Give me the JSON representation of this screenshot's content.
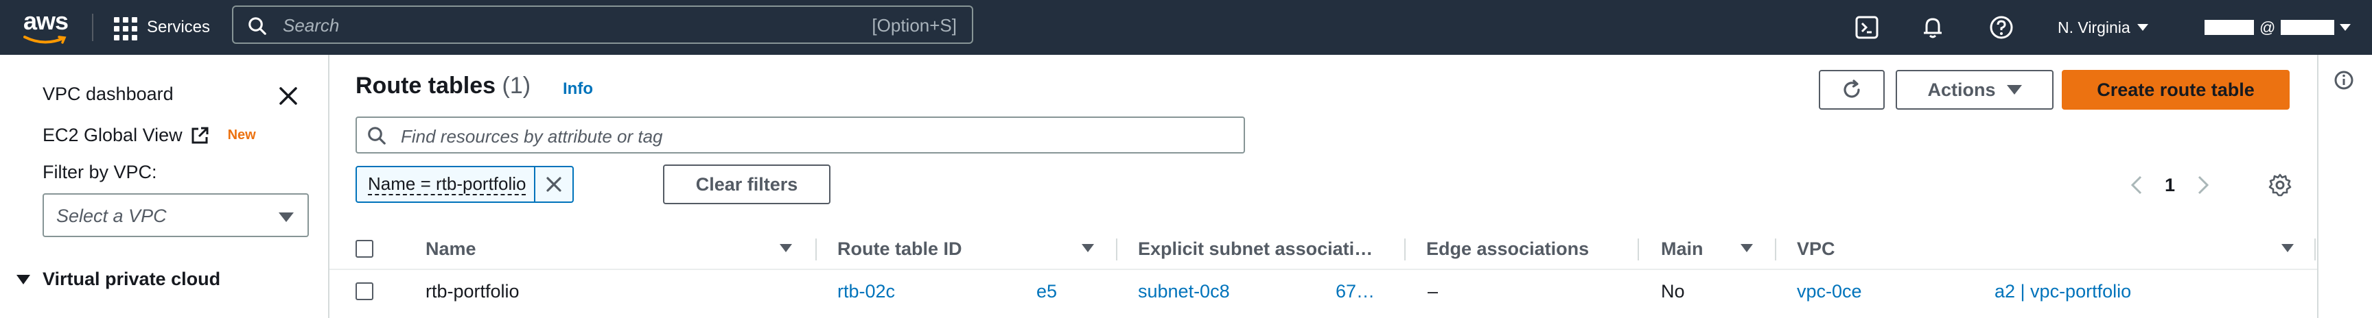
{
  "topnav": {
    "logo": "aws",
    "services_label": "Services",
    "search_placeholder": "Search",
    "search_shortcut": "[Option+S]",
    "region": "N. Virginia",
    "account_at": "@"
  },
  "sidebar": {
    "dashboard": "VPC dashboard",
    "ec2_global_view": "EC2 Global View",
    "new_badge": "New",
    "filter_label": "Filter by VPC:",
    "select_placeholder": "Select a VPC",
    "section": "Virtual private cloud"
  },
  "main": {
    "title": "Route tables",
    "count": "(1)",
    "info": "Info",
    "actions_label": "Actions",
    "create_label": "Create route table",
    "search_placeholder": "Find resources by attribute or tag",
    "filter_token": "Name = rtb-portfolio",
    "clear_filters": "Clear filters",
    "page": "1"
  },
  "table": {
    "headers": [
      "Name",
      "Route table ID",
      "Explicit subnet associati…",
      "Edge associations",
      "Main",
      "VPC"
    ],
    "rows": [
      {
        "name": "rtb-portfolio",
        "route_table_id_a": "rtb-02c",
        "route_table_id_b": "e5",
        "subnet_a": "subnet-0c8",
        "subnet_b": "67…",
        "edge": "–",
        "main": "No",
        "vpc_a": "vpc-0ce",
        "vpc_b": "a2 | vpc-portfolio"
      }
    ]
  },
  "colors": {
    "nav_bg": "#232f3e",
    "accent_orange": "#ec7211",
    "link_blue": "#0073bb"
  }
}
